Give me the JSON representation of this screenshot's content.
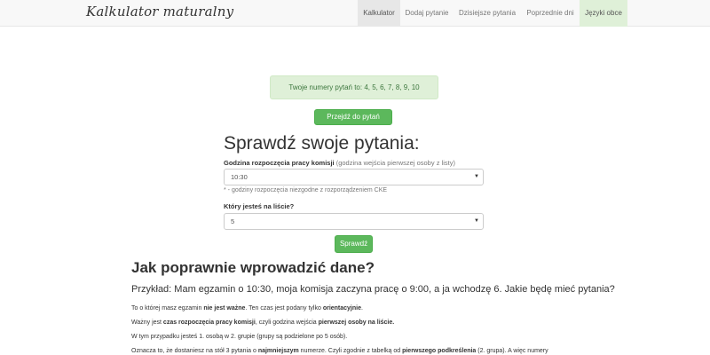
{
  "navbar": {
    "brand": "Kalkulator maturalny",
    "items": [
      "Kalkulator",
      "Dodaj pytanie",
      "Dzisiejsze pytania",
      "Poprzednie dni",
      "Języki obce"
    ]
  },
  "alert": {
    "text": "Twoje numery pytań to: 4, 5, 6, 7, 8, 9, 10"
  },
  "go_button": "Przejdź do pytań",
  "form": {
    "title": "Sprawdź swoje pytania:",
    "start_label": "Godzina rozpoczęcia pracy komisji",
    "start_hint": "(godzina wejścia pierwszej osoby z listy)",
    "start_value": "10:30",
    "start_help": "* - godziny rozpoczęcia niezgodne z rozporządzeniem CKE",
    "position_label": "Który jesteś na liście?",
    "position_value": "5",
    "submit": "Sprawdź"
  },
  "help_section": {
    "heading": "Jak poprawnie wprowadzić dane?",
    "lead": "Przykład: Mam egzamin o 10:30, moja komisja zaczyna pracę o 9:00, a ja wchodzę 6. Jakie będę mieć pytania?",
    "p1_a": "To o której masz egzamin ",
    "p1_b": "nie jest ważne",
    "p1_c": ". Ten czas jest podany tylko ",
    "p1_d": "orientacyjnie",
    "p1_e": ".",
    "p2_a": "Ważny jest ",
    "p2_b": "czas rozpoczęcia pracy komisji",
    "p2_c": ", czyli godzina wejścia ",
    "p2_d": "pierwszej osoby na liście.",
    "p3": "W tym przypadku jesteś 1. osobą w 2. grupie (grupy są podzielone po 5 osób).",
    "p4_a": "Oznacza to, że dostaniesz na stół 3 pytania o ",
    "p4_b": "najmniejszym",
    "p4_c": " numerze. Czyli zgodnie z tabelką od ",
    "p4_d": "pierwszego podkreślenia",
    "p4_e": " (2. grupa). A więc numery"
  },
  "colors": {
    "success": "#5cb85c",
    "alert_bg": "#dff0d8",
    "alert_text": "#3c763d",
    "navbar_bg": "#f8f8f8"
  }
}
